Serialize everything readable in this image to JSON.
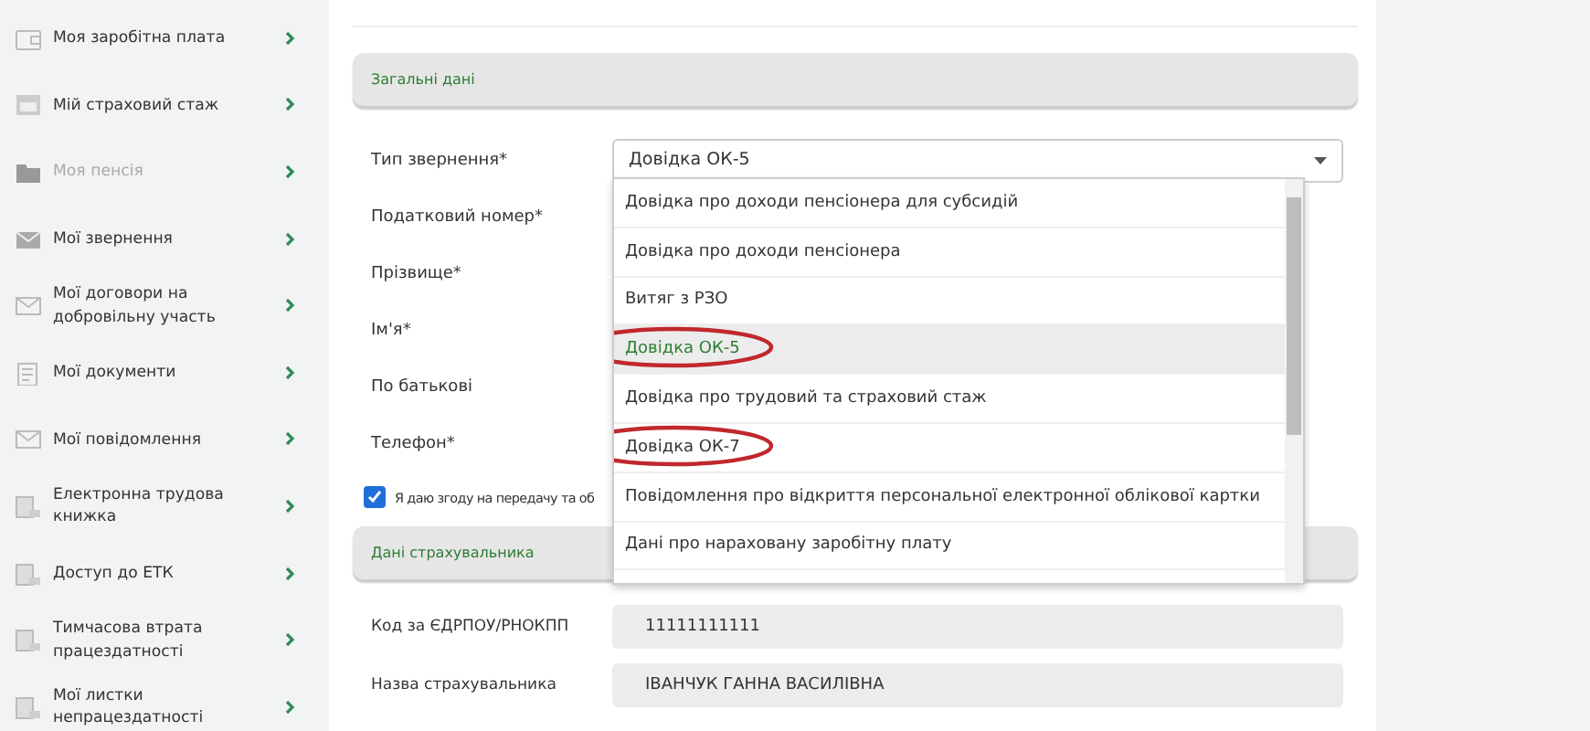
{
  "sidebar": {
    "items": [
      {
        "label": "Моя заробітна плата",
        "kind": "wallet",
        "disabled": false
      },
      {
        "label": "Мій страховий стаж",
        "kind": "calendar",
        "disabled": false
      },
      {
        "label": "Моя пенсія",
        "kind": "folder",
        "disabled": true
      },
      {
        "label": "Мої звернення",
        "kind": "envelope-filled",
        "disabled": false
      },
      {
        "label": "Мої договори на добровільну участь",
        "kind": "envelope",
        "disabled": false
      },
      {
        "label": "Мої документи",
        "kind": "document",
        "disabled": false
      },
      {
        "label": "Мої повідомлення",
        "kind": "envelope",
        "disabled": false
      },
      {
        "label": "Електронна трудова книжка",
        "kind": "book",
        "disabled": false
      },
      {
        "label": "Доступ до ЕТК",
        "kind": "book",
        "disabled": false
      },
      {
        "label": "Тимчасова втрата працездатності",
        "kind": "book",
        "disabled": false
      },
      {
        "label": "Мої листки непрацездатності",
        "kind": "book",
        "disabled": false
      }
    ]
  },
  "general_section": {
    "title": "Загальні дані",
    "fields": [
      {
        "label": "Тип звернення*",
        "kind": "select",
        "value": "Довідка ОК-5"
      },
      {
        "label": "Податковий номер*",
        "kind": "hidden"
      },
      {
        "label": "Прізвище*",
        "kind": "hidden"
      },
      {
        "label": "Ім'я*",
        "kind": "hidden"
      },
      {
        "label": "По батькові",
        "kind": "hidden"
      },
      {
        "label": "Телефон*",
        "kind": "hidden"
      }
    ],
    "consent": {
      "label": "Я даю згоду на передачу та об",
      "checked": true
    }
  },
  "dropdown": {
    "options": [
      {
        "label": "Довідка про доходи пенсіонера для субсидій",
        "selected": false,
        "circled": false
      },
      {
        "label": "Довідка про доходи пенсіонера",
        "selected": false,
        "circled": false
      },
      {
        "label": "Витяг з РЗО",
        "selected": false,
        "circled": false
      },
      {
        "label": "Довідка ОК-5",
        "selected": true,
        "circled": true
      },
      {
        "label": "Довідка про трудовий та страховий стаж",
        "selected": false,
        "circled": false
      },
      {
        "label": "Довідка ОК-7",
        "selected": false,
        "circled": true
      },
      {
        "label": "Повідомлення про відкриття персональної електронної облікової картки",
        "selected": false,
        "circled": false
      },
      {
        "label": "Дані про нараховану заробітну плату",
        "selected": false,
        "circled": false
      }
    ]
  },
  "insurer_section": {
    "title": "Дані страхувальника",
    "fields": [
      {
        "label": "Код за ЄДРПОУ/РНОКПП",
        "value": "11111111111"
      },
      {
        "label": "Назва страхувальника",
        "value": "ІВАНЧУК ГАННА ВАСИЛІВНА"
      }
    ]
  }
}
